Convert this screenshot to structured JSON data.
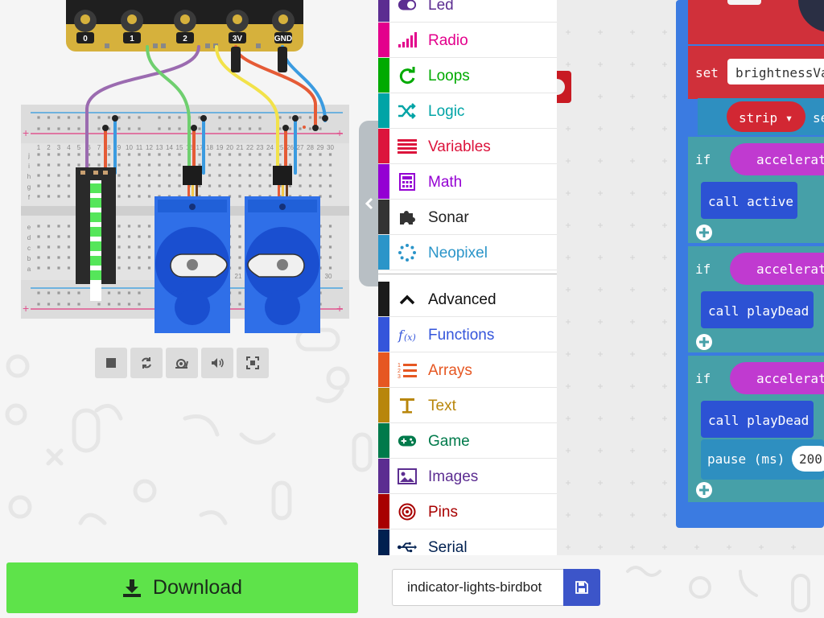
{
  "simulator": {
    "pins": [
      "0",
      "1",
      "2",
      "3V",
      "GND"
    ],
    "board_col_numbers": [
      "1",
      "2",
      "3",
      "4",
      "5",
      "6",
      "7",
      "8",
      "9",
      "10",
      "11",
      "12",
      "13",
      "14",
      "15",
      "16",
      "17",
      "18",
      "19",
      "20",
      "21",
      "22",
      "23",
      "24",
      "25",
      "26",
      "27",
      "28",
      "29",
      "30"
    ],
    "board_row_letters_top": [
      "j",
      "i",
      "h",
      "g",
      "f"
    ],
    "board_row_letters_bottom": [
      "e",
      "d",
      "c",
      "b",
      "a"
    ],
    "board_bottom_numbers": [
      "21",
      "30"
    ],
    "toolbar": [
      "stop-icon",
      "restart-icon",
      "slow-mode-icon",
      "mute-icon",
      "fullscreen-icon"
    ]
  },
  "toolbox": {
    "categories": [
      {
        "label": "Led",
        "color": "#5c2d91",
        "icon": "toggle-icon"
      },
      {
        "label": "Radio",
        "color": "#e3008c",
        "icon": "signal-bars-icon"
      },
      {
        "label": "Loops",
        "color": "#00aa00",
        "icon": "loop-arrow-icon"
      },
      {
        "label": "Logic",
        "color": "#00a4a6",
        "icon": "shuffle-icon"
      },
      {
        "label": "Variables",
        "color": "#dc143c",
        "icon": "lines-icon"
      },
      {
        "label": "Math",
        "color": "#9400d3",
        "icon": "calculator-icon"
      },
      {
        "label": "Sonar",
        "color": "#000000",
        "icon": "puzzle-icon"
      },
      {
        "label": "Neopixel",
        "color": "#2b95c9",
        "icon": "dotted-circle-icon"
      },
      {
        "label": "Advanced",
        "color": "#1b1b1b",
        "icon": "chevron-up-icon"
      },
      {
        "label": "Functions",
        "color": "#3455db",
        "icon": "function-icon"
      },
      {
        "label": "Arrays",
        "color": "#e65722",
        "icon": "numbered-list-icon"
      },
      {
        "label": "Text",
        "color": "#b8860b",
        "icon": "text-icon"
      },
      {
        "label": "Game",
        "color": "#007a4b",
        "icon": "gamepad-icon"
      },
      {
        "label": "Images",
        "color": "#5c2d91",
        "icon": "image-icon"
      },
      {
        "label": "Pins",
        "color": "#a80000",
        "icon": "target-icon"
      },
      {
        "label": "Serial",
        "color": "#002050",
        "icon": "usb-icon"
      }
    ]
  },
  "workspace": {
    "set_keyword": "set",
    "set_variable": "brightnessVa",
    "strip_label": "strip ▾",
    "strip_suffix": "se",
    "if_keyword": "if",
    "condition_1": "accelerat",
    "condition_2": "accelerat",
    "condition_3": "accelerat",
    "call_1": "call active",
    "call_2": "call playDead",
    "call_3": "call playDead",
    "pause_label": "pause (ms)",
    "pause_value": "200"
  },
  "bottombar": {
    "download_label": "Download",
    "project_name": "indicator-lights-birdbot"
  }
}
